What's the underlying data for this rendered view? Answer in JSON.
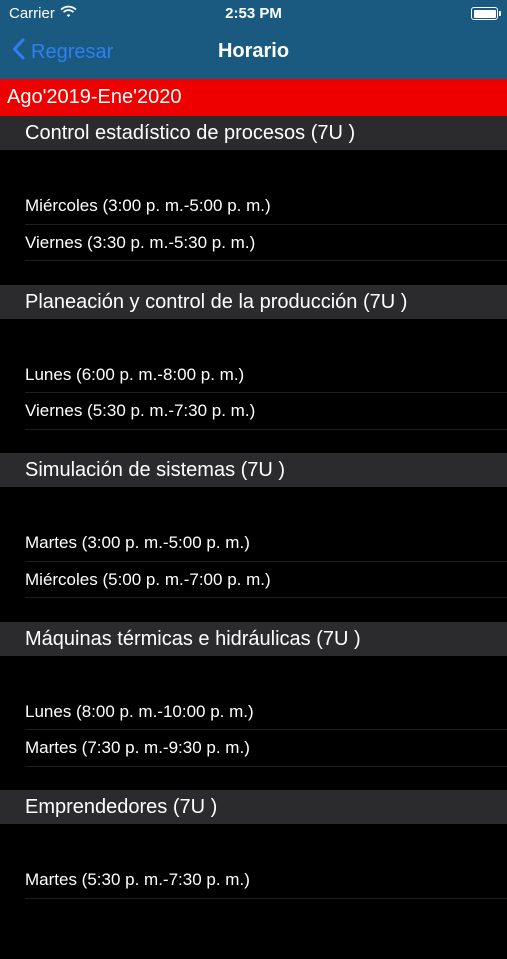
{
  "status_bar": {
    "carrier": "Carrier",
    "time": "2:53 PM",
    "battery_level": 1.0
  },
  "nav": {
    "back_label": "Regresar",
    "title": "Horario"
  },
  "period": "Ago'2019-Ene'2020",
  "colors": {
    "header_bg": "#1a5a80",
    "banner_bg": "#ee0000",
    "section_bg": "#2b2b2d",
    "accent": "#2f7ff0"
  },
  "courses": [
    {
      "name": "Control estadístico de procesos (7U )",
      "sessions": [
        "Miércoles (3:00 p. m.-5:00 p. m.)",
        "Viernes (3:30 p. m.-5:30 p. m.)"
      ]
    },
    {
      "name": "Planeación y control de la producción (7U )",
      "sessions": [
        "Lunes (6:00 p. m.-8:00 p. m.)",
        "Viernes (5:30 p. m.-7:30 p. m.)"
      ]
    },
    {
      "name": "Simulación de sistemas (7U )",
      "sessions": [
        "Martes (3:00 p. m.-5:00 p. m.)",
        "Miércoles (5:00 p. m.-7:00 p. m.)"
      ]
    },
    {
      "name": "Máquinas térmicas e hidráulicas (7U )",
      "sessions": [
        "Lunes (8:00 p. m.-10:00 p. m.)",
        "Martes (7:30 p. m.-9:30 p. m.)"
      ]
    },
    {
      "name": "Emprendedores (7U )",
      "sessions": [
        "Martes (5:30 p. m.-7:30 p. m.)"
      ]
    }
  ]
}
